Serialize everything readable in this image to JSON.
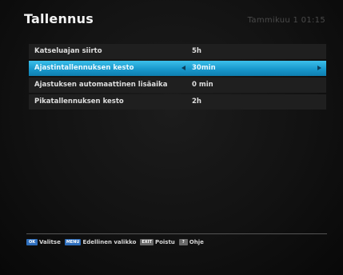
{
  "header": {
    "title": "Tallennus",
    "datetime": "Tammikuu 1 01:15"
  },
  "menu": {
    "items": [
      {
        "label": "Katseluajan siirto",
        "value": "5h",
        "selected": false
      },
      {
        "label": "Ajastintallennuksen kesto",
        "value": "30min",
        "selected": true
      },
      {
        "label": "Ajastuksen automaattinen lisäaika",
        "value": "0 min",
        "selected": false
      },
      {
        "label": "Pikatallennuksen kesto",
        "value": "2h",
        "selected": false
      }
    ]
  },
  "footer": {
    "ok_key": "OK",
    "ok_label": "Valitse",
    "menu_key": "MENU",
    "menu_label": "Edellinen valikko",
    "exit_key": "EXIT",
    "exit_label": "Poistu",
    "help_key": "?",
    "help_label": "Ohje"
  },
  "colors": {
    "selected_row": "#1898cc",
    "row_background": "#1f1f1f",
    "key_blue": "#2f6fbd",
    "key_grey": "#6a6a6a"
  }
}
